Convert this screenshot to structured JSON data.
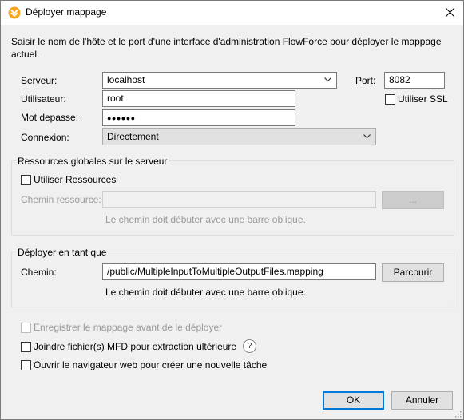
{
  "window": {
    "title": "Déployer mappage",
    "close_glyph": "✕",
    "app_icon": "altova-mapforce-icon"
  },
  "intro": "Saisir le nom de l'hôte et le port d'une interface d'administration FlowForce pour déployer le mappage actuel.",
  "server": {
    "server_label": "Serveur:",
    "server_value": "localhost",
    "port_label": "Port:",
    "port_value": "8082",
    "use_ssl_label": "Utiliser SSL",
    "use_ssl_checked": false,
    "user_label": "Utilisateur:",
    "user_value": "root",
    "password_label": "Mot depasse:",
    "password_value": "●●●●●●",
    "connection_label": "Connexion:",
    "connection_value": "Directement"
  },
  "resources": {
    "group_title": "Ressources globales sur le serveur",
    "use_resources_label": "Utiliser Ressources",
    "use_resources_checked": false,
    "path_label": "Chemin ressource:",
    "path_value": "",
    "browse_label": "...",
    "hint": "Le chemin doit débuter avec une barre oblique."
  },
  "deploy_as": {
    "group_title": "Déployer en tant que",
    "path_label": "Chemin:",
    "path_value": "/public/MultipleInputToMultipleOutputFiles.mapping",
    "browse_label": "Parcourir",
    "hint": "Le chemin doit débuter avec une barre oblique."
  },
  "options": {
    "save_before_deploy": "Enregistrer le mappage avant de le déployer",
    "attach_mfd": "Joindre fichier(s) MFD pour extraction ultérieure",
    "help_glyph": "?",
    "open_browser": "Ouvrir le navigateur web pour créer une nouvelle tâche"
  },
  "buttons": {
    "ok": "OK",
    "cancel": "Annuler"
  },
  "colors": {
    "dialog_bg": "#f0f0f0",
    "default_button_border": "#0078d7",
    "icon_orange": "#f5a623"
  }
}
